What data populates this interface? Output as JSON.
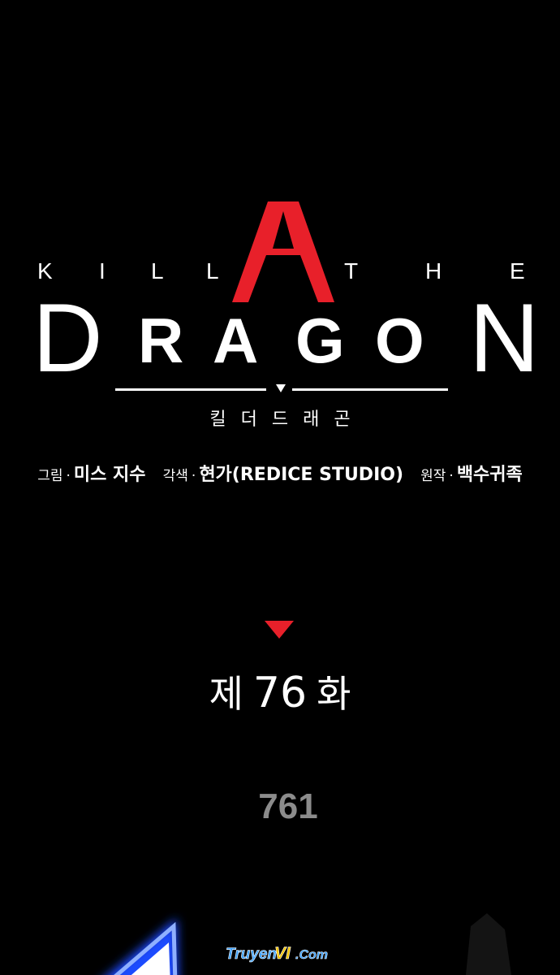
{
  "title_logo": {
    "line1_letters": [
      "K",
      "I",
      "L",
      "L",
      "T",
      "H",
      "E"
    ],
    "line2_letters": [
      "D",
      "R",
      "A",
      "G",
      "O",
      "N"
    ],
    "big_red_letter": "A",
    "korean_title": "킬더드래곤",
    "accent_color": "#e8202a"
  },
  "credits": {
    "art_role": "그림",
    "art_name": "미스 지수",
    "script_role": "각색",
    "script_name": "현가(REDICE STUDIO)",
    "original_role": "원작",
    "original_name": "백수귀족",
    "separator": "·"
  },
  "chapter": {
    "prefix": "제",
    "number": "76",
    "suffix": "화",
    "marker_color": "#e8202a"
  },
  "page_number": "761",
  "watermark": {
    "text_part1": "Truyen",
    "text_part2": "VI",
    "text_part3": ".Com"
  }
}
